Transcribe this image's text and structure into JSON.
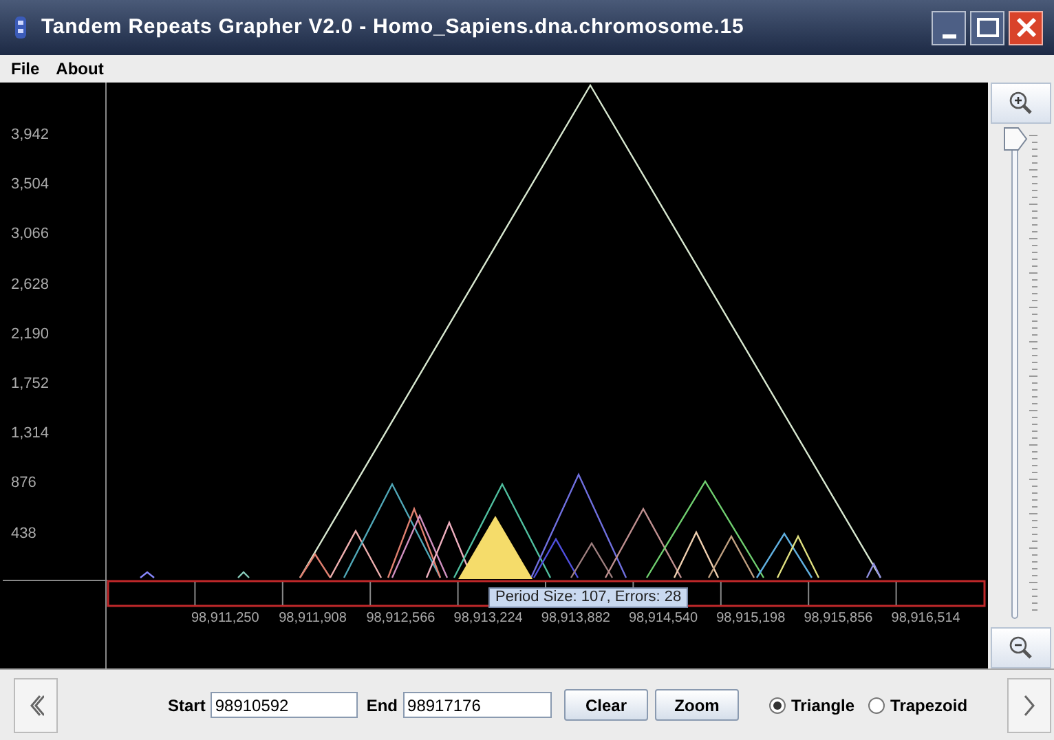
{
  "window": {
    "title": "Tandem Repeats Grapher V2.0 - Homo_Sapiens.dna.chromosome.15"
  },
  "menu": [
    "File",
    "About"
  ],
  "plot": {
    "y_labels": [
      "3,942",
      "3,504",
      "3,066",
      "2,628",
      "2,190",
      "1,752",
      "1,314",
      "876",
      "438"
    ],
    "x_labels": [
      "98,911,250",
      "98,911,908",
      "98,912,566",
      "98,913,224",
      "98,913,882",
      "98,914,540",
      "98,915,198",
      "98,915,856",
      "98,916,514"
    ],
    "tooltip": "Period Size: 107, Errors: 28"
  },
  "zoom_slider": {
    "level": 1.0
  },
  "controls": {
    "start_label": "Start",
    "start_value": "98910592",
    "end_label": "End",
    "end_value": "98917176",
    "buttons": [
      "Clear",
      "Zoom"
    ],
    "shapes": [
      {
        "label": "Triangle",
        "selected": true
      },
      {
        "label": "Trapezoid",
        "selected": false
      }
    ]
  }
}
